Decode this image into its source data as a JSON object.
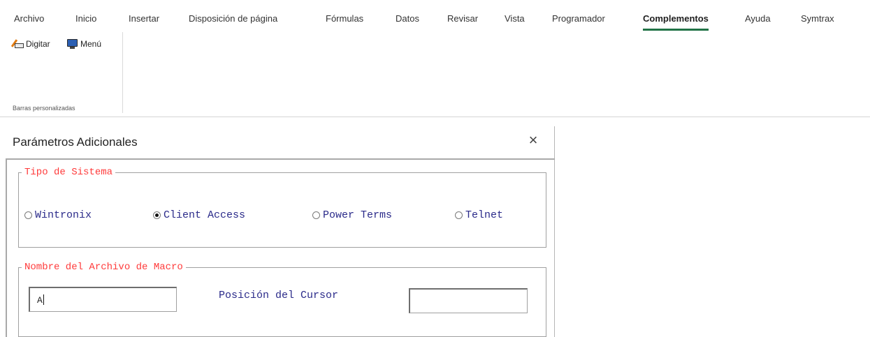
{
  "ribbon": {
    "tabs": [
      {
        "label": "Archivo"
      },
      {
        "label": "Inicio"
      },
      {
        "label": "Insertar"
      },
      {
        "label": "Disposición de página"
      },
      {
        "label": "Fórmulas"
      },
      {
        "label": "Datos"
      },
      {
        "label": "Revisar"
      },
      {
        "label": "Vista"
      },
      {
        "label": "Programador"
      },
      {
        "label": "Complementos",
        "active": true
      },
      {
        "label": "Ayuda"
      },
      {
        "label": "Symtrax"
      }
    ],
    "active_tab_color": "#217346",
    "group": {
      "label": "Barras personalizadas",
      "buttons": [
        {
          "label": "Digitar",
          "icon": "digitar-icon"
        },
        {
          "label": "Menú",
          "icon": "menu-icon"
        }
      ]
    }
  },
  "dialog": {
    "title": "Parámetros Adicionales",
    "close_icon": "close-icon",
    "system_frame": {
      "legend": "Tipo de Sistema",
      "options": [
        {
          "label": "Wintronix",
          "checked": false
        },
        {
          "label": "Client Access",
          "checked": true
        },
        {
          "label": "Power Terms",
          "checked": false
        },
        {
          "label": "Telnet",
          "checked": false
        }
      ]
    },
    "macro_frame": {
      "legend": "Nombre del Archivo de Macro",
      "macro_value": "A",
      "cursor_label": "Posición del Cursor",
      "cursor_value": ""
    },
    "legend_color": "#ff3a3a",
    "label_color": "#2b2b8a"
  }
}
